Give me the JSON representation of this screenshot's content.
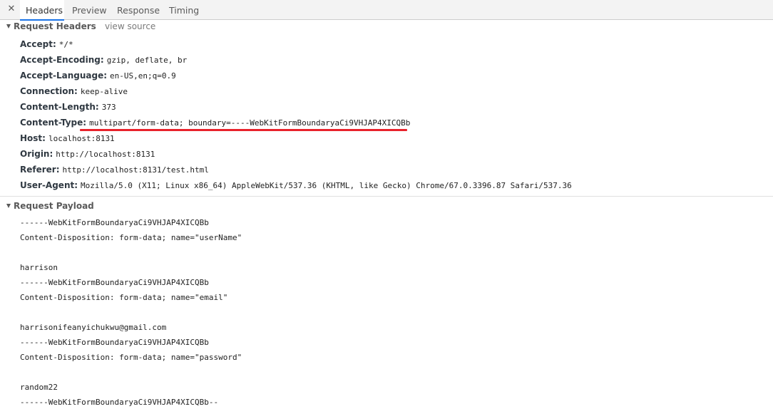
{
  "tabs": {
    "close_label": "✕",
    "items": [
      {
        "label": "Headers",
        "active": true
      },
      {
        "label": "Preview",
        "active": false
      },
      {
        "label": "Response",
        "active": false
      },
      {
        "label": "Timing",
        "active": false
      }
    ]
  },
  "request_headers": {
    "title": "Request Headers",
    "view_source": "view source",
    "rows": [
      {
        "name": "Accept:",
        "value": "*/*"
      },
      {
        "name": "Accept-Encoding:",
        "value": "gzip, deflate, br"
      },
      {
        "name": "Accept-Language:",
        "value": "en-US,en;q=0.9"
      },
      {
        "name": "Connection:",
        "value": "keep-alive"
      },
      {
        "name": "Content-Length:",
        "value": "373"
      },
      {
        "name": "Content-Type:",
        "value": "multipart/form-data; boundary=----WebKitFormBoundaryaCi9VHJAP4XICQBb",
        "highlighted": true
      },
      {
        "name": "Host:",
        "value": "localhost:8131"
      },
      {
        "name": "Origin:",
        "value": "http://localhost:8131"
      },
      {
        "name": "Referer:",
        "value": "http://localhost:8131/test.html"
      },
      {
        "name": "User-Agent:",
        "value": "Mozilla/5.0 (X11; Linux x86_64) AppleWebKit/537.36 (KHTML, like Gecko) Chrome/67.0.3396.87 Safari/537.36"
      }
    ]
  },
  "request_payload": {
    "title": "Request Payload",
    "lines": [
      "------WebKitFormBoundaryaCi9VHJAP4XICQBb",
      "Content-Disposition: form-data; name=\"userName\"",
      "",
      "harrison",
      "------WebKitFormBoundaryaCi9VHJAP4XICQBb",
      "Content-Disposition: form-data; name=\"email\"",
      "",
      "harrisonifeanyichukwu@gmail.com",
      "------WebKitFormBoundaryaCi9VHJAP4XICQBb",
      "Content-Disposition: form-data; name=\"password\"",
      "",
      "random22",
      "------WebKitFormBoundaryaCi9VHJAP4XICQBb--"
    ]
  },
  "colors": {
    "highlight_underline": "#e8222b",
    "active_tab_indicator": "#1a73e8"
  },
  "icons": {
    "close": "close-icon",
    "collapse": "triangle-down-icon"
  }
}
